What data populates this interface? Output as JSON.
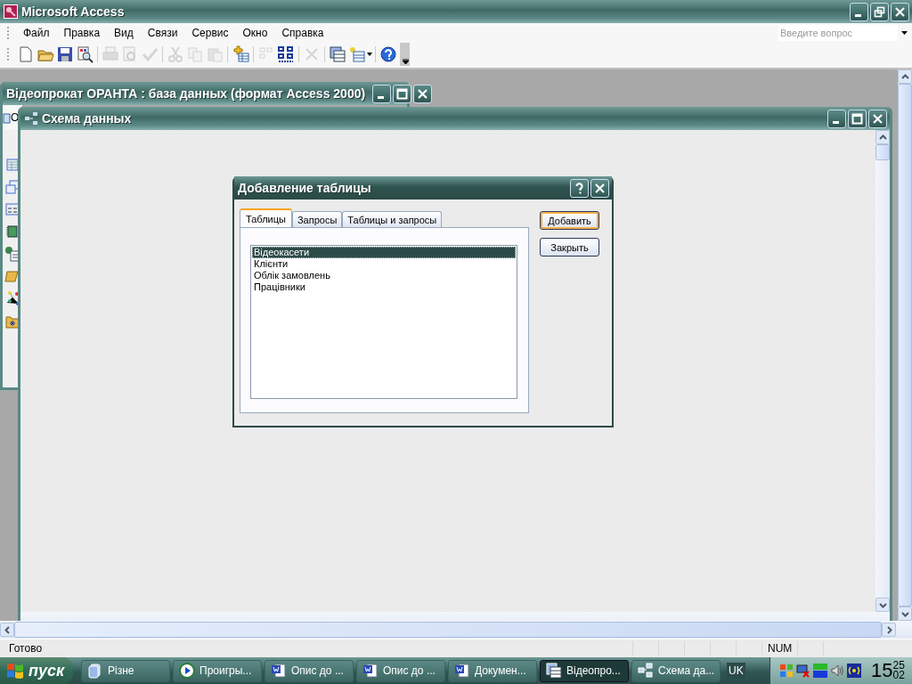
{
  "app_window": {
    "title": "Microsoft Access"
  },
  "menu": [
    {
      "label": "Файл"
    },
    {
      "label": "Правка"
    },
    {
      "label": "Вид"
    },
    {
      "label": "Связи"
    },
    {
      "label": "Сервис"
    },
    {
      "label": "Окно"
    },
    {
      "label": "Справка"
    }
  ],
  "help_search": {
    "placeholder": "Введите вопрос"
  },
  "toolbar": [
    {
      "disabled": false
    },
    {
      "disabled": false
    },
    {
      "disabled": false
    },
    {
      "disabled": false
    },
    {
      "disabled": true
    },
    {
      "disabled": true
    },
    {
      "disabled": true
    },
    {
      "disabled": true
    },
    {
      "disabled": true
    },
    {
      "disabled": true
    },
    {
      "disabled": false
    },
    {
      "disabled": true
    },
    {
      "disabled": false
    },
    {
      "disabled": true
    },
    {
      "disabled": false
    },
    {
      "disabled": false
    },
    {
      "disabled": false
    }
  ],
  "database_window": {
    "title": "Відеопрокат ОРАНТА : база данных (формат Access 2000)",
    "toolbar_text": "О"
  },
  "schema_window": {
    "title": "Схема данных"
  },
  "dialog": {
    "title": "Добавление таблицы",
    "tabs": [
      {
        "label": "Таблицы",
        "selected": true
      },
      {
        "label": "Запросы",
        "selected": false
      },
      {
        "label": "Таблицы и запросы",
        "selected": false
      }
    ],
    "items": [
      {
        "label": "Відеокасети",
        "selected": true
      },
      {
        "label": "Клієнти",
        "selected": false
      },
      {
        "label": "Облік замовлень",
        "selected": false
      },
      {
        "label": "Працівники",
        "selected": false
      }
    ],
    "buttons": [
      {
        "label": "Добавить",
        "default": true
      },
      {
        "label": "Закрыть",
        "default": false
      }
    ]
  },
  "status_bar": {
    "text": "Готово",
    "indicator": "NUM"
  },
  "taskbar": {
    "start": "пуск",
    "items": [
      {
        "label": "Різне",
        "selected": false
      },
      {
        "label": "Проигры...",
        "selected": false
      },
      {
        "label": "Опис до ...",
        "selected": false
      },
      {
        "label": "Опис до ...",
        "selected": false
      },
      {
        "label": "Докумен...",
        "selected": false
      },
      {
        "label": "Відеопро...",
        "selected": true
      },
      {
        "label": "Схема да...",
        "selected": false
      }
    ],
    "language": "UK",
    "clock": {
      "hours": "15",
      "minutes": "25",
      "seconds": "02"
    }
  }
}
